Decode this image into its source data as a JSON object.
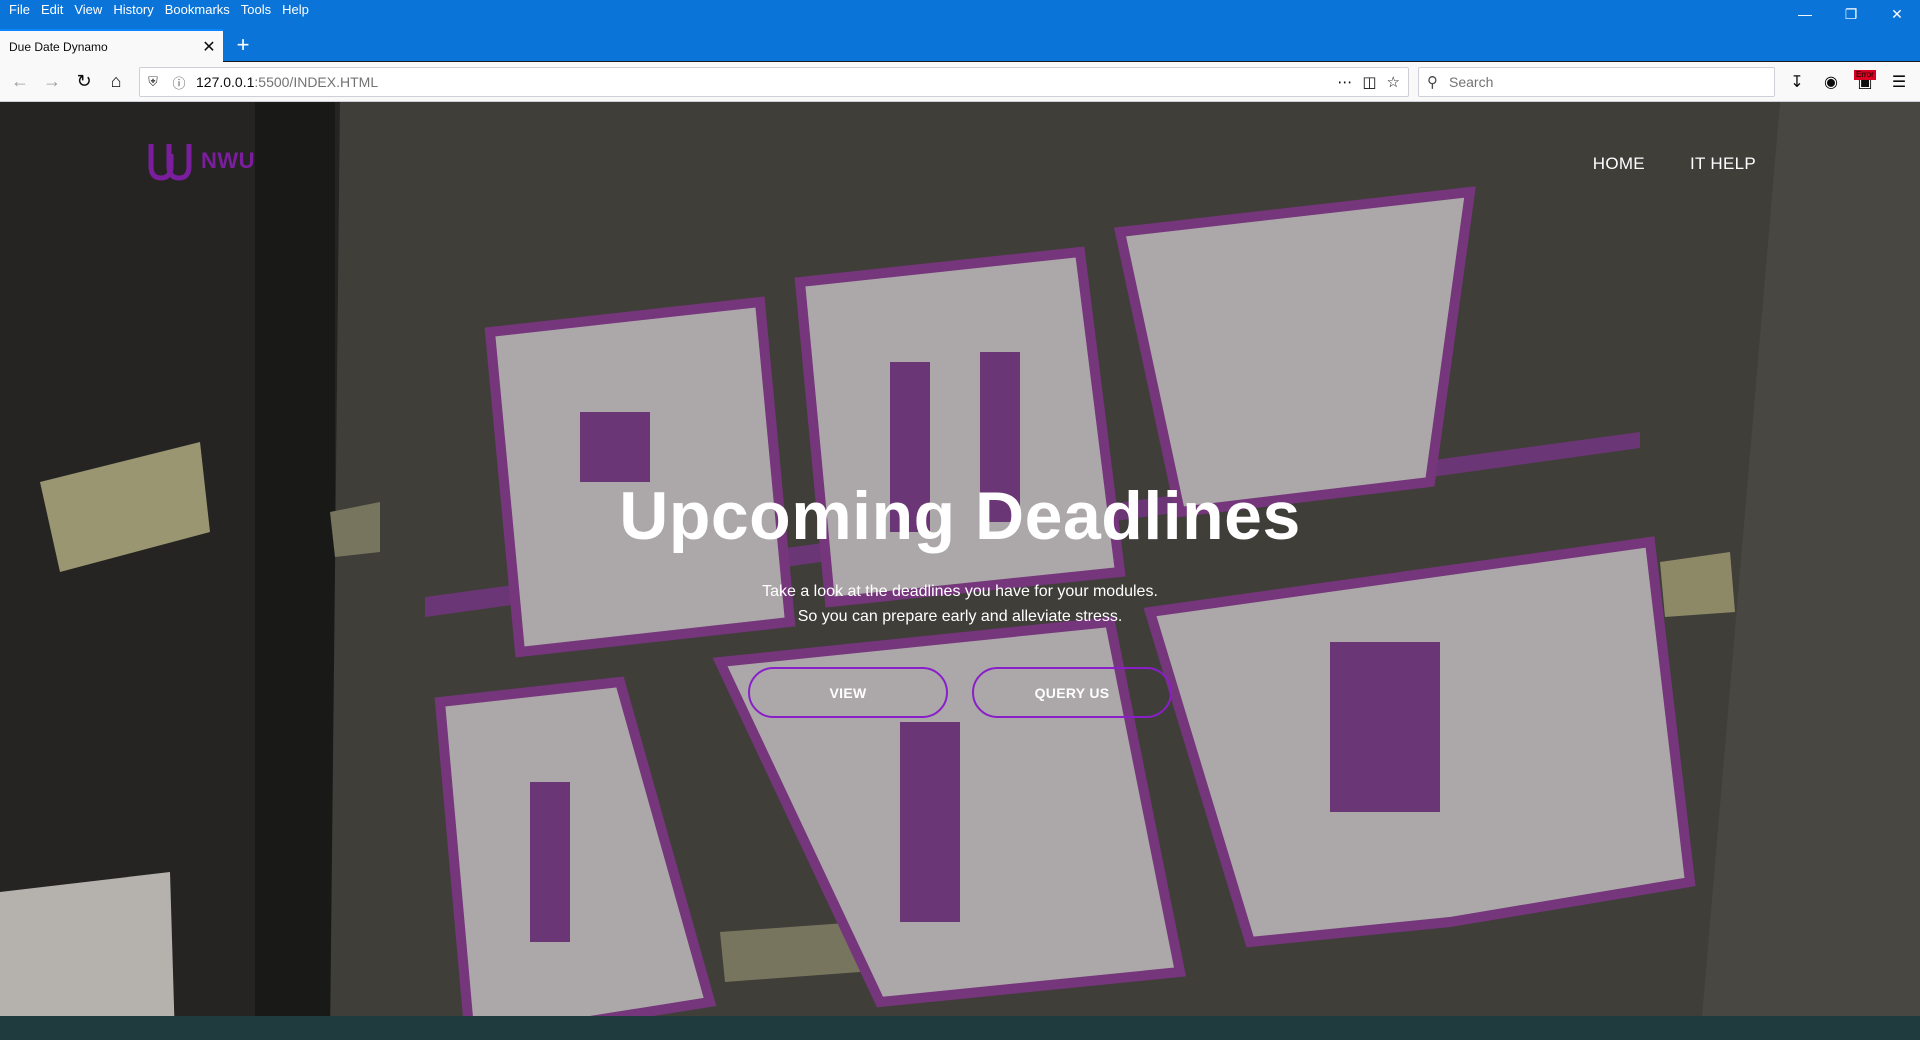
{
  "browser": {
    "menu": [
      "File",
      "Edit",
      "View",
      "History",
      "Bookmarks",
      "Tools",
      "Help"
    ],
    "tab_title": "Due Date Dynamo",
    "url_host": "127.0.0.1",
    "url_path": ":5500/INDEX.HTML",
    "search_placeholder": "Search",
    "error_badge": "Error"
  },
  "site": {
    "logo_text": "NWU",
    "nav": [
      "HOME",
      "IT HELP"
    ]
  },
  "hero": {
    "title": "Upcoming Deadlines",
    "subtitle_line1": "Take a look at the deadlines you have for your modules.",
    "subtitle_line2": "So you can prepare early and alleviate stress.",
    "buttons": [
      "VIEW",
      "QUERY US"
    ]
  },
  "colors": {
    "accent": "#8a1fc9",
    "brand": "#7b1e9e",
    "browser_blue": "#0a74d9"
  }
}
